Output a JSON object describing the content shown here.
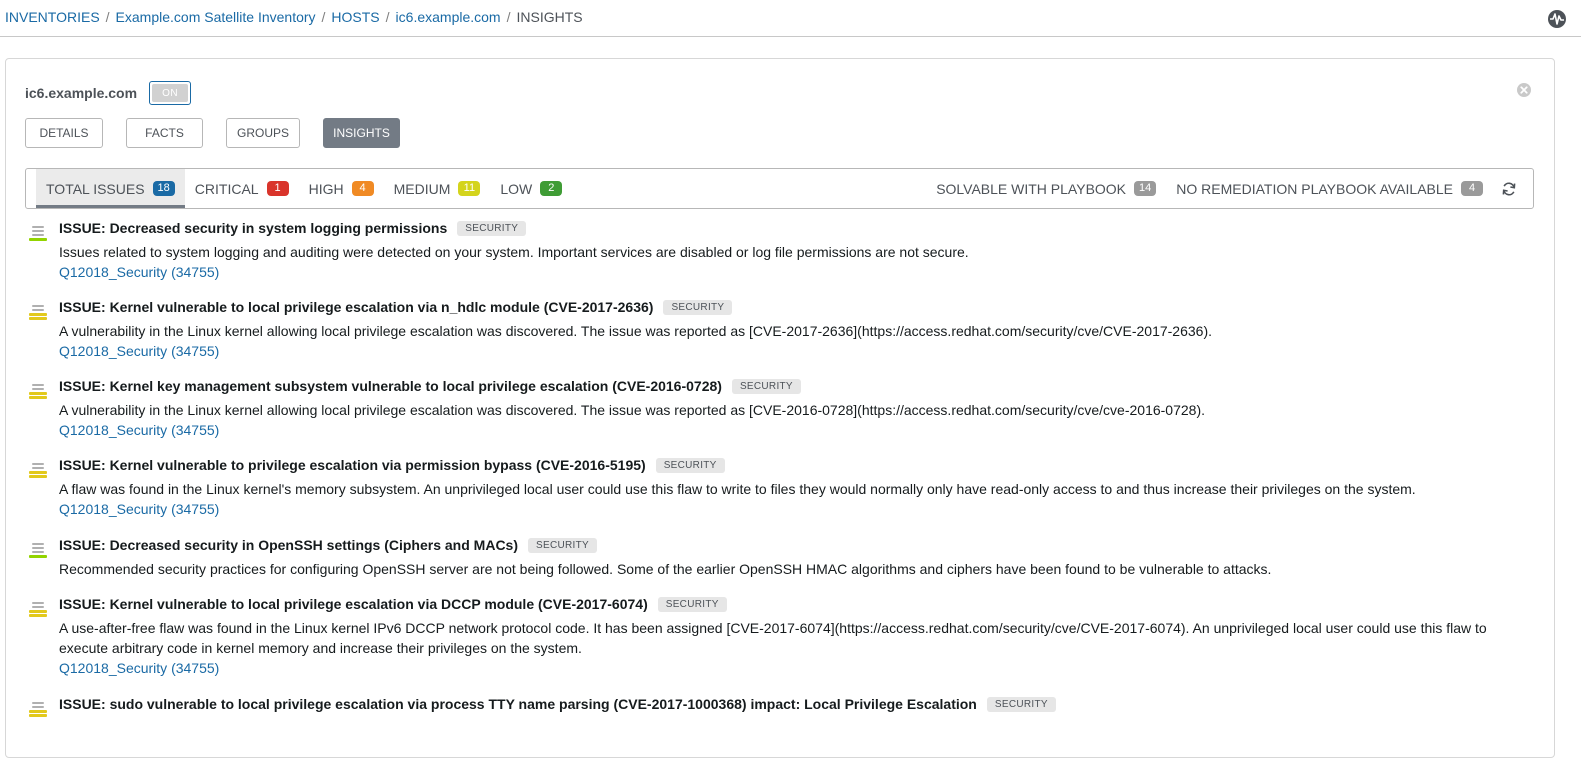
{
  "breadcrumb": [
    {
      "label": "INVENTORIES",
      "link": true
    },
    {
      "label": "Example.com Satellite Inventory",
      "link": true
    },
    {
      "label": "HOSTS",
      "link": true
    },
    {
      "label": "ic6.example.com",
      "link": true
    },
    {
      "label": "INSIGHTS",
      "link": false
    }
  ],
  "host": {
    "name": "ic6.example.com",
    "toggle_label": "ON"
  },
  "tabs": [
    {
      "label": "DETAILS",
      "active": false
    },
    {
      "label": "FACTS",
      "active": false
    },
    {
      "label": "GROUPS",
      "active": false
    },
    {
      "label": "INSIGHTS",
      "active": true
    }
  ],
  "filters": {
    "left": [
      {
        "label": "TOTAL ISSUES",
        "count": "18",
        "color": "#1a6aa5",
        "active": true
      },
      {
        "label": "CRITICAL",
        "count": "1",
        "color": "#d9342b",
        "active": false
      },
      {
        "label": "HIGH",
        "count": "4",
        "color": "#f08a24",
        "active": false
      },
      {
        "label": "MEDIUM",
        "count": "11",
        "color": "#d4d41c",
        "active": false
      },
      {
        "label": "LOW",
        "count": "2",
        "color": "#3f9c35",
        "active": false
      }
    ],
    "right": [
      {
        "label": "SOLVABLE WITH PLAYBOOK",
        "count": "14",
        "color": "#9a9a9a"
      },
      {
        "label": "NO REMEDIATION PLAYBOOK AVAILABLE",
        "count": "4",
        "color": "#9a9a9a"
      }
    ]
  },
  "issues": [
    {
      "severity": "low",
      "severity_color": "#92d400",
      "title": "ISSUE: Decreased security in system logging permissions",
      "tag": "SECURITY",
      "description": "Issues related to system logging and auditing were detected on your system. Important services are disabled or log file permissions are not secure.",
      "link": "Q12018_Security (34755)"
    },
    {
      "severity": "medium",
      "severity_color": "#e2c91c",
      "title": "ISSUE: Kernel vulnerable to local privilege escalation via n_hdlc module (CVE-2017-2636)",
      "tag": "SECURITY",
      "description": "A vulnerability in the Linux kernel allowing local privilege escalation was discovered. The issue was reported as [CVE-2017-2636](https://access.redhat.com/security/cve/CVE-2017-2636).",
      "link": "Q12018_Security (34755)"
    },
    {
      "severity": "medium",
      "severity_color": "#e2c91c",
      "title": "ISSUE: Kernel key management subsystem vulnerable to local privilege escalation (CVE-2016-0728)",
      "tag": "SECURITY",
      "description": "A vulnerability in the Linux kernel allowing local privilege escalation was discovered. The issue was reported as [CVE-2016-0728](https://access.redhat.com/security/cve/cve-2016-0728).",
      "link": "Q12018_Security (34755)"
    },
    {
      "severity": "medium",
      "severity_color": "#e2c91c",
      "title": "ISSUE: Kernel vulnerable to privilege escalation via permission bypass (CVE-2016-5195)",
      "tag": "SECURITY",
      "description": "A flaw was found in the Linux kernel's memory subsystem. An unprivileged local user could use this flaw to write to files they would normally only have read-only access to and thus increase their privileges on the system.",
      "link": "Q12018_Security (34755)"
    },
    {
      "severity": "low",
      "severity_color": "#92d400",
      "title": "ISSUE: Decreased security in OpenSSH settings (Ciphers and MACs)",
      "tag": "SECURITY",
      "description": "Recommended security practices for configuring OpenSSH server are not being followed. Some of the earlier OpenSSH HMAC algorithms and ciphers have been found to be vulnerable to attacks.",
      "link": ""
    },
    {
      "severity": "medium",
      "severity_color": "#e2c91c",
      "title": "ISSUE: Kernel vulnerable to local privilege escalation via DCCP module (CVE-2017-6074)",
      "tag": "SECURITY",
      "description": "A use-after-free flaw was found in the Linux kernel IPv6 DCCP network protocol code. It has been assigned [CVE-2017-6074](https://access.redhat.com/security/cve/CVE-2017-6074). An unprivileged local user could use this flaw to execute arbitrary code in kernel memory and increase their privileges on the system.",
      "link": "Q12018_Security (34755)"
    },
    {
      "severity": "medium",
      "severity_color": "#e2c91c",
      "title": "ISSUE: sudo vulnerable to local privilege escalation via process TTY name parsing (CVE-2017-1000368) impact: Local Privilege Escalation",
      "tag": "SECURITY",
      "description": "",
      "link": ""
    }
  ]
}
